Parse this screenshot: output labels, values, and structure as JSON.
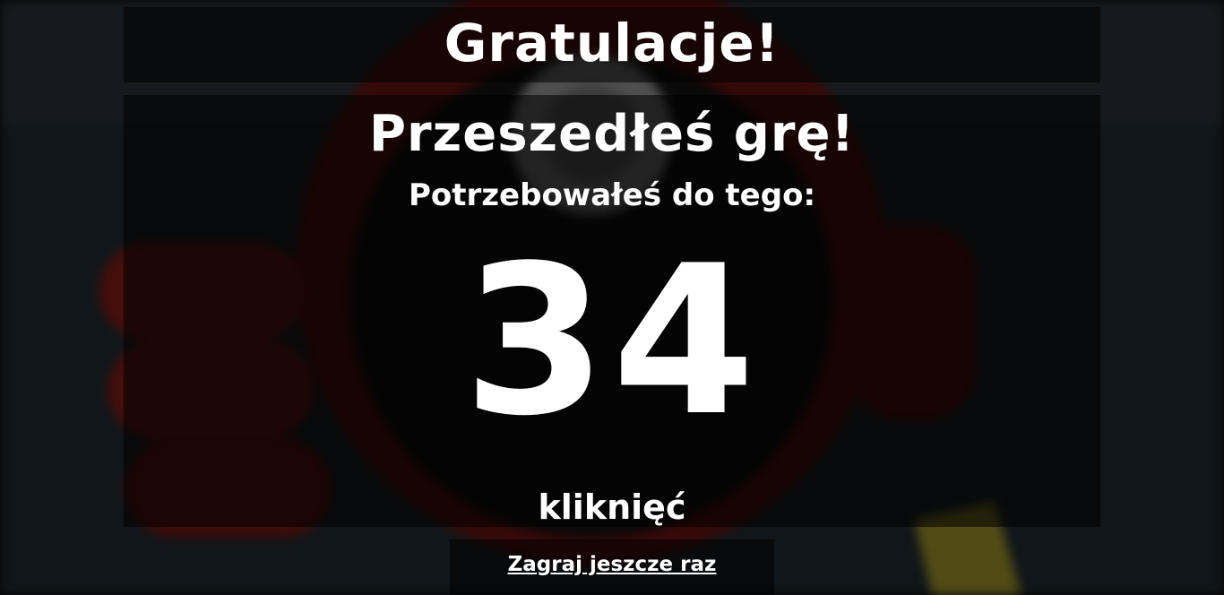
{
  "result": {
    "title": "Gratulacje!",
    "subtitle": "Przeszedłeś grę!",
    "needed_label": "Potrzebowałeś do tego:",
    "click_count": "34",
    "click_unit": "kliknięć"
  },
  "actions": {
    "play_again_label": "Zagraj jeszcze raz"
  },
  "colors": {
    "text": "#ffffff",
    "overlay": "#000000",
    "accent_red": "#b3261e",
    "accent_yellow": "#d9c63a"
  },
  "background": {
    "icon": "pokeball-hand-illustration"
  }
}
